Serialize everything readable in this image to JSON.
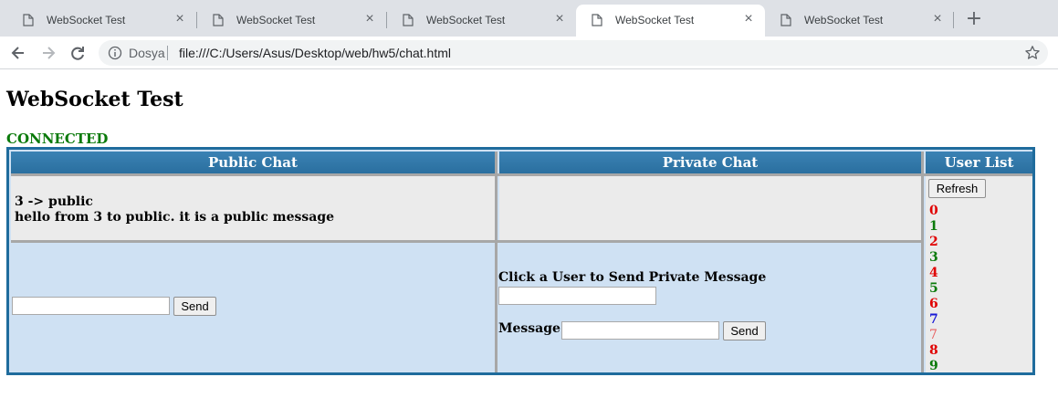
{
  "browser": {
    "tabs": [
      {
        "title": "WebSocket Test",
        "active": false
      },
      {
        "title": "WebSocket Test",
        "active": false
      },
      {
        "title": "WebSocket Test",
        "active": false
      },
      {
        "title": "WebSocket Test",
        "active": true
      },
      {
        "title": "WebSocket Test",
        "active": false
      }
    ],
    "new_tab_icon": "plus-icon",
    "security_chip": "Dosya",
    "url": "file:///C:/Users/Asus/Desktop/web/hw5/chat.html"
  },
  "page": {
    "title": "WebSocket Test",
    "status": "CONNECTED",
    "status_color": "#0a7a0a"
  },
  "chat": {
    "headers": {
      "public": "Public Chat",
      "private": "Private Chat",
      "users": "User List"
    },
    "header_color": "#2a6f9f",
    "public_messages": [
      "3 -> public",
      "hello from 3 to public. it is a public message"
    ],
    "public_input_value": "",
    "public_send_label": "Send",
    "private_prompt": "Click a User to Send Private Message",
    "private_user_value": "",
    "private_message_label": "Message",
    "private_message_value": "",
    "private_send_label": "Send",
    "refresh_label": "Refresh",
    "users": [
      {
        "name": "0",
        "color": "#e00000"
      },
      {
        "name": "1",
        "color": "#0a7a0a"
      },
      {
        "name": "2",
        "color": "#e00000"
      },
      {
        "name": "3",
        "color": "#0a7a0a"
      },
      {
        "name": "4",
        "color": "#e00000"
      },
      {
        "name": "5",
        "color": "#0a7a0a"
      },
      {
        "name": "6",
        "color": "#e00000"
      },
      {
        "name": "7",
        "color": "#1a1ad6"
      },
      {
        "name": "7",
        "color": "#e86060"
      },
      {
        "name": "8",
        "color": "#e00000"
      },
      {
        "name": "9",
        "color": "#0a7a0a"
      }
    ]
  }
}
